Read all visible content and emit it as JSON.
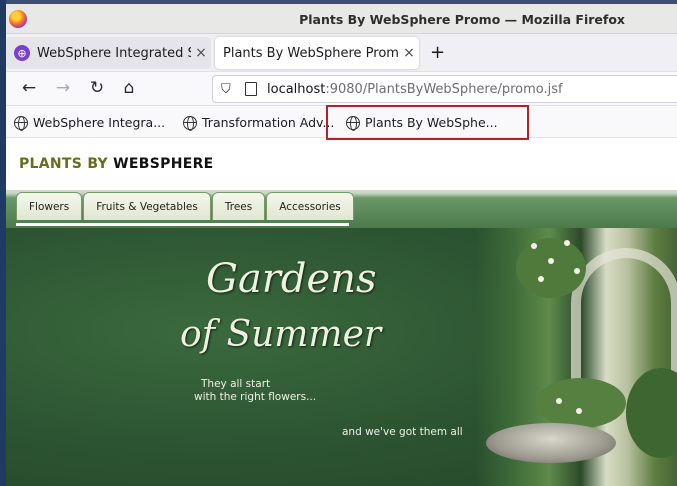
{
  "window": {
    "title": "Plants By WebSphere Promo — Mozilla Firefox"
  },
  "tabs": [
    {
      "label": "WebSphere Integrated S",
      "active": false
    },
    {
      "label": "Plants By WebSphere Promo",
      "active": true
    }
  ],
  "nav": {
    "url_host": "localhost",
    "url_path": ":9080/PlantsByWebSphere/promo.jsf"
  },
  "bookmarks": [
    {
      "label": "WebSphere Integra..."
    },
    {
      "label": "Transformation Adv..."
    },
    {
      "label": "Plants By WebSphe..."
    }
  ],
  "site": {
    "brand_part1": "PLANTS BY ",
    "brand_part2": "WEBSPHERE",
    "categories": [
      "Flowers",
      "Fruits & Vegetables",
      "Trees",
      "Accessories"
    ]
  },
  "hero": {
    "title_line1": "Gardens",
    "title_line2": "of Summer",
    "tag_line1": "They all start",
    "tag_line2": "with the right flowers...",
    "tag_line3": "and we've got them all"
  },
  "colors": {
    "highlight_box": "#b0232a",
    "hero_green": "#2f5a34",
    "brand_olive": "#6b6a1d"
  }
}
